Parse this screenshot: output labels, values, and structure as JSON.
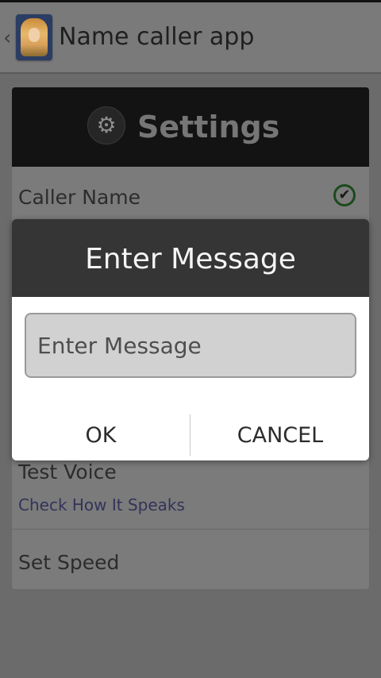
{
  "app_bar": {
    "title": "Name caller app",
    "back_glyph": "‹",
    "icon": "app-avatar-icon"
  },
  "settings": {
    "header_title": "Settings",
    "gear_glyph": "⚙",
    "items": [
      {
        "title": "Caller Name",
        "checked": true
      },
      {
        "title": "Test Voice",
        "summary": "Check How It Speaks"
      },
      {
        "title": "Set Speed",
        "summary": ""
      }
    ]
  },
  "dialog": {
    "title": "Enter Message",
    "input": {
      "value": "",
      "placeholder": "Enter Message"
    },
    "ok_label": "OK",
    "cancel_label": "CANCEL"
  },
  "colors": {
    "scrim": "#6b6b6b",
    "settings_header": "#131313",
    "dialog_title_bg": "#353535",
    "dialog_body_bg": "#ffffff",
    "input_bg": "#d1d1d1",
    "summary_text": "#33335a"
  }
}
